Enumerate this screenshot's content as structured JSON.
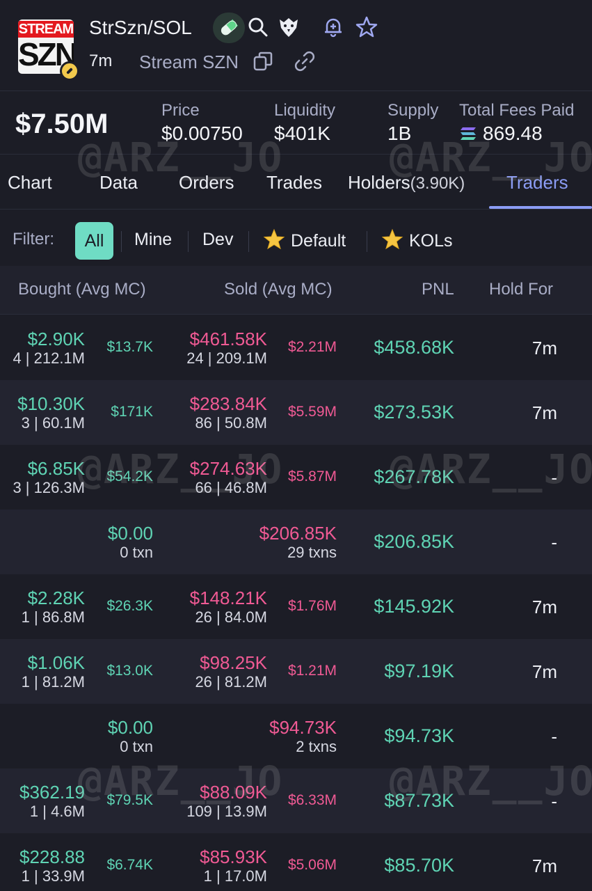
{
  "header": {
    "logo_top": "STREAM",
    "logo_bottom": "SZN",
    "pair": "StrSzn/SOL",
    "age": "7m",
    "token_name": "Stream SZN"
  },
  "stats": {
    "market_cap": "$7.50M",
    "price_label": "Price",
    "price": "$0.00750",
    "liquidity_label": "Liquidity",
    "liquidity": "$401K",
    "supply_label": "Supply",
    "supply": "1B",
    "fees_label": "Total Fees Paid",
    "fees": "869.48"
  },
  "tabs": [
    {
      "label": "Chart"
    },
    {
      "label": "Data"
    },
    {
      "label": "Orders"
    },
    {
      "label": "Trades"
    },
    {
      "label": "Holders",
      "count": "(3.90K)"
    },
    {
      "label": "Traders"
    }
  ],
  "filter": {
    "label": "Filter:",
    "options": [
      "All",
      "Mine",
      "Dev",
      "Default",
      "KOLs"
    ]
  },
  "table": {
    "headers": [
      "Bought (Avg MC)",
      "Sold (Avg MC)",
      "PNL",
      "Hold For"
    ],
    "rows": [
      {
        "bought": "$2.90K",
        "bought_sub": "4 | 212.1M",
        "bought_mc": "$13.7K",
        "sold": "$461.58K",
        "sold_sub": "24 | 209.1M",
        "sold_mc": "$2.21M",
        "pnl": "$458.68K",
        "hold": "7m"
      },
      {
        "bought": "$10.30K",
        "bought_sub": "3 | 60.1M",
        "bought_mc": "$171K",
        "sold": "$283.84K",
        "sold_sub": "86 | 50.8M",
        "sold_mc": "$5.59M",
        "pnl": "$273.53K",
        "hold": "7m"
      },
      {
        "bought": "$6.85K",
        "bought_sub": "3 | 126.3M",
        "bought_mc": "$54.2K",
        "sold": "$274.63K",
        "sold_sub": "66 | 46.8M",
        "sold_mc": "$5.87M",
        "pnl": "$267.78K",
        "hold": "-"
      },
      {
        "bought": "$0.00",
        "bought_sub": "0 txn",
        "bought_mc": "",
        "sold": "$206.85K",
        "sold_sub": "29 txns",
        "sold_mc": "",
        "pnl": "$206.85K",
        "hold": "-"
      },
      {
        "bought": "$2.28K",
        "bought_sub": "1 | 86.8M",
        "bought_mc": "$26.3K",
        "sold": "$148.21K",
        "sold_sub": "26 | 84.0M",
        "sold_mc": "$1.76M",
        "pnl": "$145.92K",
        "hold": "7m"
      },
      {
        "bought": "$1.06K",
        "bought_sub": "1 | 81.2M",
        "bought_mc": "$13.0K",
        "sold": "$98.25K",
        "sold_sub": "26 | 81.2M",
        "sold_mc": "$1.21M",
        "pnl": "$97.19K",
        "hold": "7m"
      },
      {
        "bought": "$0.00",
        "bought_sub": "0 txn",
        "bought_mc": "",
        "sold": "$94.73K",
        "sold_sub": "2 txns",
        "sold_mc": "",
        "pnl": "$94.73K",
        "hold": "-"
      },
      {
        "bought": "$362.19",
        "bought_sub": "1 | 4.6M",
        "bought_mc": "$79.5K",
        "sold": "$88.09K",
        "sold_sub": "109 | 13.9M",
        "sold_mc": "$6.33M",
        "pnl": "$87.73K",
        "hold": "-"
      },
      {
        "bought": "$228.88",
        "bought_sub": "1 | 33.9M",
        "bought_mc": "$6.74K",
        "sold": "$85.93K",
        "sold_sub": "1 | 17.0M",
        "sold_mc": "$5.06M",
        "pnl": "$85.70K",
        "hold": "7m"
      }
    ]
  },
  "watermark": "@ARZ__JO"
}
